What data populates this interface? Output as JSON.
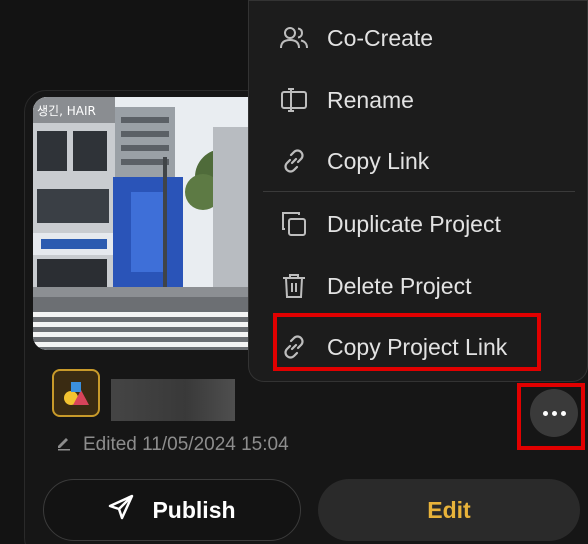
{
  "menu": {
    "items": [
      {
        "label": "Co-Create",
        "icon": "users-icon"
      },
      {
        "label": "Rename",
        "icon": "rename-icon"
      },
      {
        "label": "Copy Link",
        "icon": "link-icon"
      },
      {
        "label": "Duplicate Project",
        "icon": "duplicate-icon"
      },
      {
        "label": "Delete Project",
        "icon": "trash-icon"
      },
      {
        "label": "Copy Project Link",
        "icon": "link-icon"
      }
    ]
  },
  "card": {
    "edited_text": "Edited 11/05/2024 15:04",
    "publish_label": "Publish",
    "edit_label": "Edit",
    "thumbnail_sign_text": "생긴, HAIR"
  },
  "colors": {
    "accent": "#e8b33a",
    "highlight": "#e10000",
    "background": "#131313"
  }
}
